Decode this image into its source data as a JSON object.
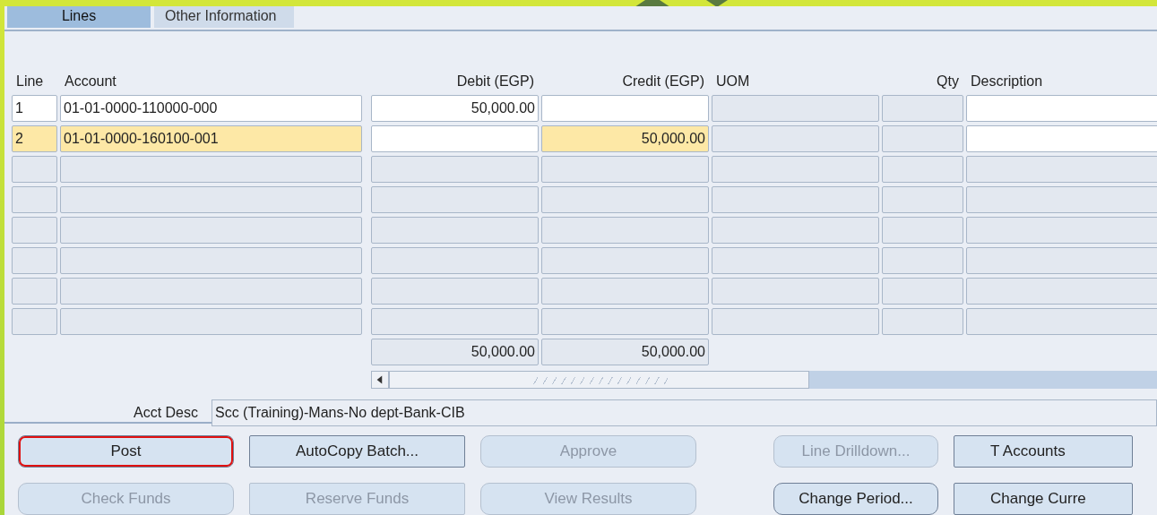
{
  "tabs": [
    {
      "label": "Lines",
      "selected": true
    },
    {
      "label": "Other Information",
      "selected": false
    }
  ],
  "columns": {
    "line": "Line",
    "account": "Account",
    "debit": "Debit (EGP)",
    "credit": "Credit (EGP)",
    "uom": "UOM",
    "qty": "Qty",
    "description": "Description"
  },
  "rows": [
    {
      "line": "1",
      "account": "01-01-0000-110000-000",
      "debit": "50,000.00",
      "selected": false,
      "enabled": true
    },
    {
      "line": "2",
      "account": "01-01-0000-160100-001",
      "credit": "50,000.00",
      "selected": true,
      "enabled": true
    },
    {
      "selected": false,
      "enabled": false
    },
    {
      "selected": false,
      "enabled": false
    },
    {
      "selected": false,
      "enabled": false
    },
    {
      "selected": false,
      "enabled": false
    },
    {
      "selected": false,
      "enabled": false
    },
    {
      "selected": false,
      "enabled": false
    }
  ],
  "totals": {
    "debit": "50,000.00",
    "credit": "50,000.00"
  },
  "acct_desc": {
    "label": "Acct Desc",
    "value": "Scc (Training)-Mans-No dept-Bank-CIB"
  },
  "buttons": [
    {
      "label": "Post",
      "disabled": false,
      "focused": true,
      "kind": "square"
    },
    {
      "label": "AutoCopy Batch...",
      "disabled": false,
      "focused": false,
      "kind": "square"
    },
    {
      "label": "Approve",
      "disabled": true,
      "focused": false,
      "kind": "round"
    },
    {
      "label": "Line Drilldown...",
      "disabled": true,
      "focused": false,
      "kind": "round"
    },
    {
      "label": "T Accounts",
      "disabled": false,
      "focused": false,
      "kind": "square"
    },
    {
      "label": "Check Funds",
      "disabled": true,
      "focused": false,
      "kind": "round"
    },
    {
      "label": "Reserve Funds",
      "disabled": true,
      "focused": false,
      "kind": "square"
    },
    {
      "label": "View Results",
      "disabled": true,
      "focused": false,
      "kind": "round"
    },
    {
      "label": "Change Period...",
      "disabled": false,
      "focused": false,
      "kind": "round"
    },
    {
      "label": "Change Curre",
      "disabled": false,
      "focused": false,
      "kind": "square"
    }
  ]
}
